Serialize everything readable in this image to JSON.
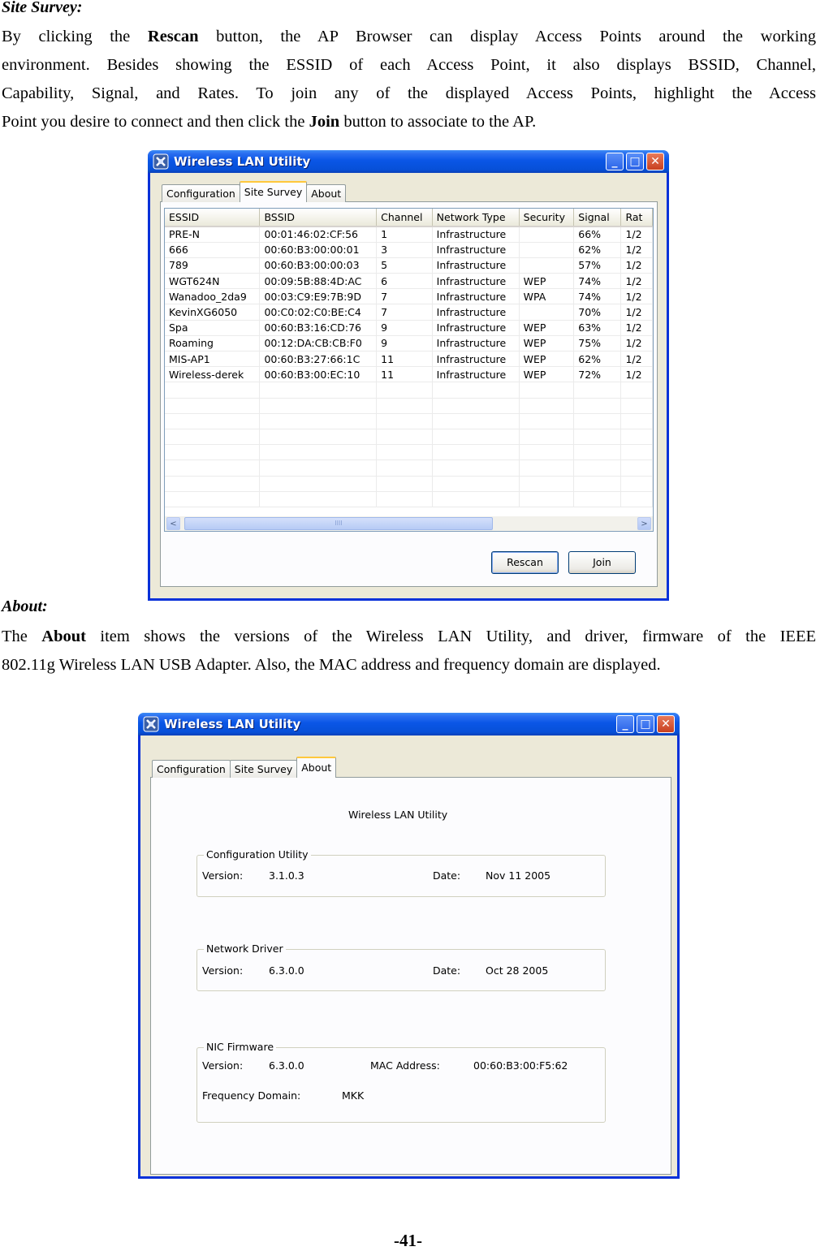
{
  "site_survey": {
    "heading": "Site Survey:",
    "para": {
      "l1_a": "By clicking the ",
      "l1_b": "Rescan",
      "l1_c": " button, the AP Browser can display Access Points around the working",
      "l2": "environment. Besides showing the ESSID of each Access Point, it also displays BSSID, Channel,",
      "l3": "Capability, Signal, and Rates. To join any of the displayed Access Points, highlight the Access",
      "l4_a": "Point you desire to connect and then click the ",
      "l4_b": "Join",
      "l4_c": " button to associate to the AP."
    }
  },
  "about_section": {
    "heading": "About:",
    "para": {
      "l1_a": "The ",
      "l1_b": "About",
      "l1_c": " item shows the versions of the Wireless LAN Utility, and driver, firmware of the IEEE",
      "l2": "802.11g Wireless LAN USB Adapter. Also, the MAC address and frequency domain are displayed."
    }
  },
  "window_title": "Wireless LAN Utility",
  "window_buttons": {
    "minimize": "_",
    "maximize": "□",
    "close": "✕"
  },
  "tabs": [
    "Configuration",
    "Site Survey",
    "About"
  ],
  "survey": {
    "columns": [
      "ESSID",
      "BSSID",
      "Channel",
      "Network Type",
      "Security",
      "Signal",
      "Rat"
    ],
    "rows": [
      [
        "PRE-N",
        "00:01:46:02:CF:56",
        "1",
        "Infrastructure",
        "",
        "66%",
        "1/2"
      ],
      [
        "666",
        "00:60:B3:00:00:01",
        "3",
        "Infrastructure",
        "",
        "62%",
        "1/2"
      ],
      [
        "789",
        "00:60:B3:00:00:03",
        "5",
        "Infrastructure",
        "",
        "57%",
        "1/2"
      ],
      [
        "WGT624N",
        "00:09:5B:88:4D:AC",
        "6",
        "Infrastructure",
        "WEP",
        "74%",
        "1/2"
      ],
      [
        "Wanadoo_2da9",
        "00:03:C9:E9:7B:9D",
        "7",
        "Infrastructure",
        "WPA",
        "74%",
        "1/2"
      ],
      [
        "KevinXG6050",
        "00:C0:02:C0:BE:C4",
        "7",
        "Infrastructure",
        "",
        "70%",
        "1/2"
      ],
      [
        "Spa",
        "00:60:B3:16:CD:76",
        "9",
        "Infrastructure",
        "WEP",
        "63%",
        "1/2"
      ],
      [
        "Roaming",
        "00:12:DA:CB:CB:F0",
        "9",
        "Infrastructure",
        "WEP",
        "75%",
        "1/2"
      ],
      [
        "MIS-AP1",
        "00:60:B3:27:66:1C",
        "11",
        "Infrastructure",
        "WEP",
        "62%",
        "1/2"
      ],
      [
        "Wireless-derek",
        "00:60:B3:00:EC:10",
        "11",
        "Infrastructure",
        "WEP",
        "72%",
        "1/2"
      ]
    ],
    "scroll_left": "<",
    "scroll_right": ">",
    "thumb_grip": "IIII",
    "rescan_label": "Rescan",
    "join_label": "Join"
  },
  "about": {
    "title": "Wireless LAN Utility",
    "config_group": "Configuration Utility",
    "config_version_label": "Version:",
    "config_version": "3.1.0.3",
    "config_date_label": "Date:",
    "config_date": "Nov 11 2005",
    "driver_group": "Network Driver",
    "driver_version_label": "Version:",
    "driver_version": "6.3.0.0",
    "driver_date_label": "Date:",
    "driver_date": "Oct 28 2005",
    "nic_group": "NIC Firmware",
    "nic_version_label": "Version:",
    "nic_version": "6.3.0.0",
    "mac_label": "MAC Address:",
    "mac": "00:60:B3:00:F5:62",
    "freq_label": "Frequency Domain:",
    "freq": "MKK"
  },
  "page_number": "-41-"
}
